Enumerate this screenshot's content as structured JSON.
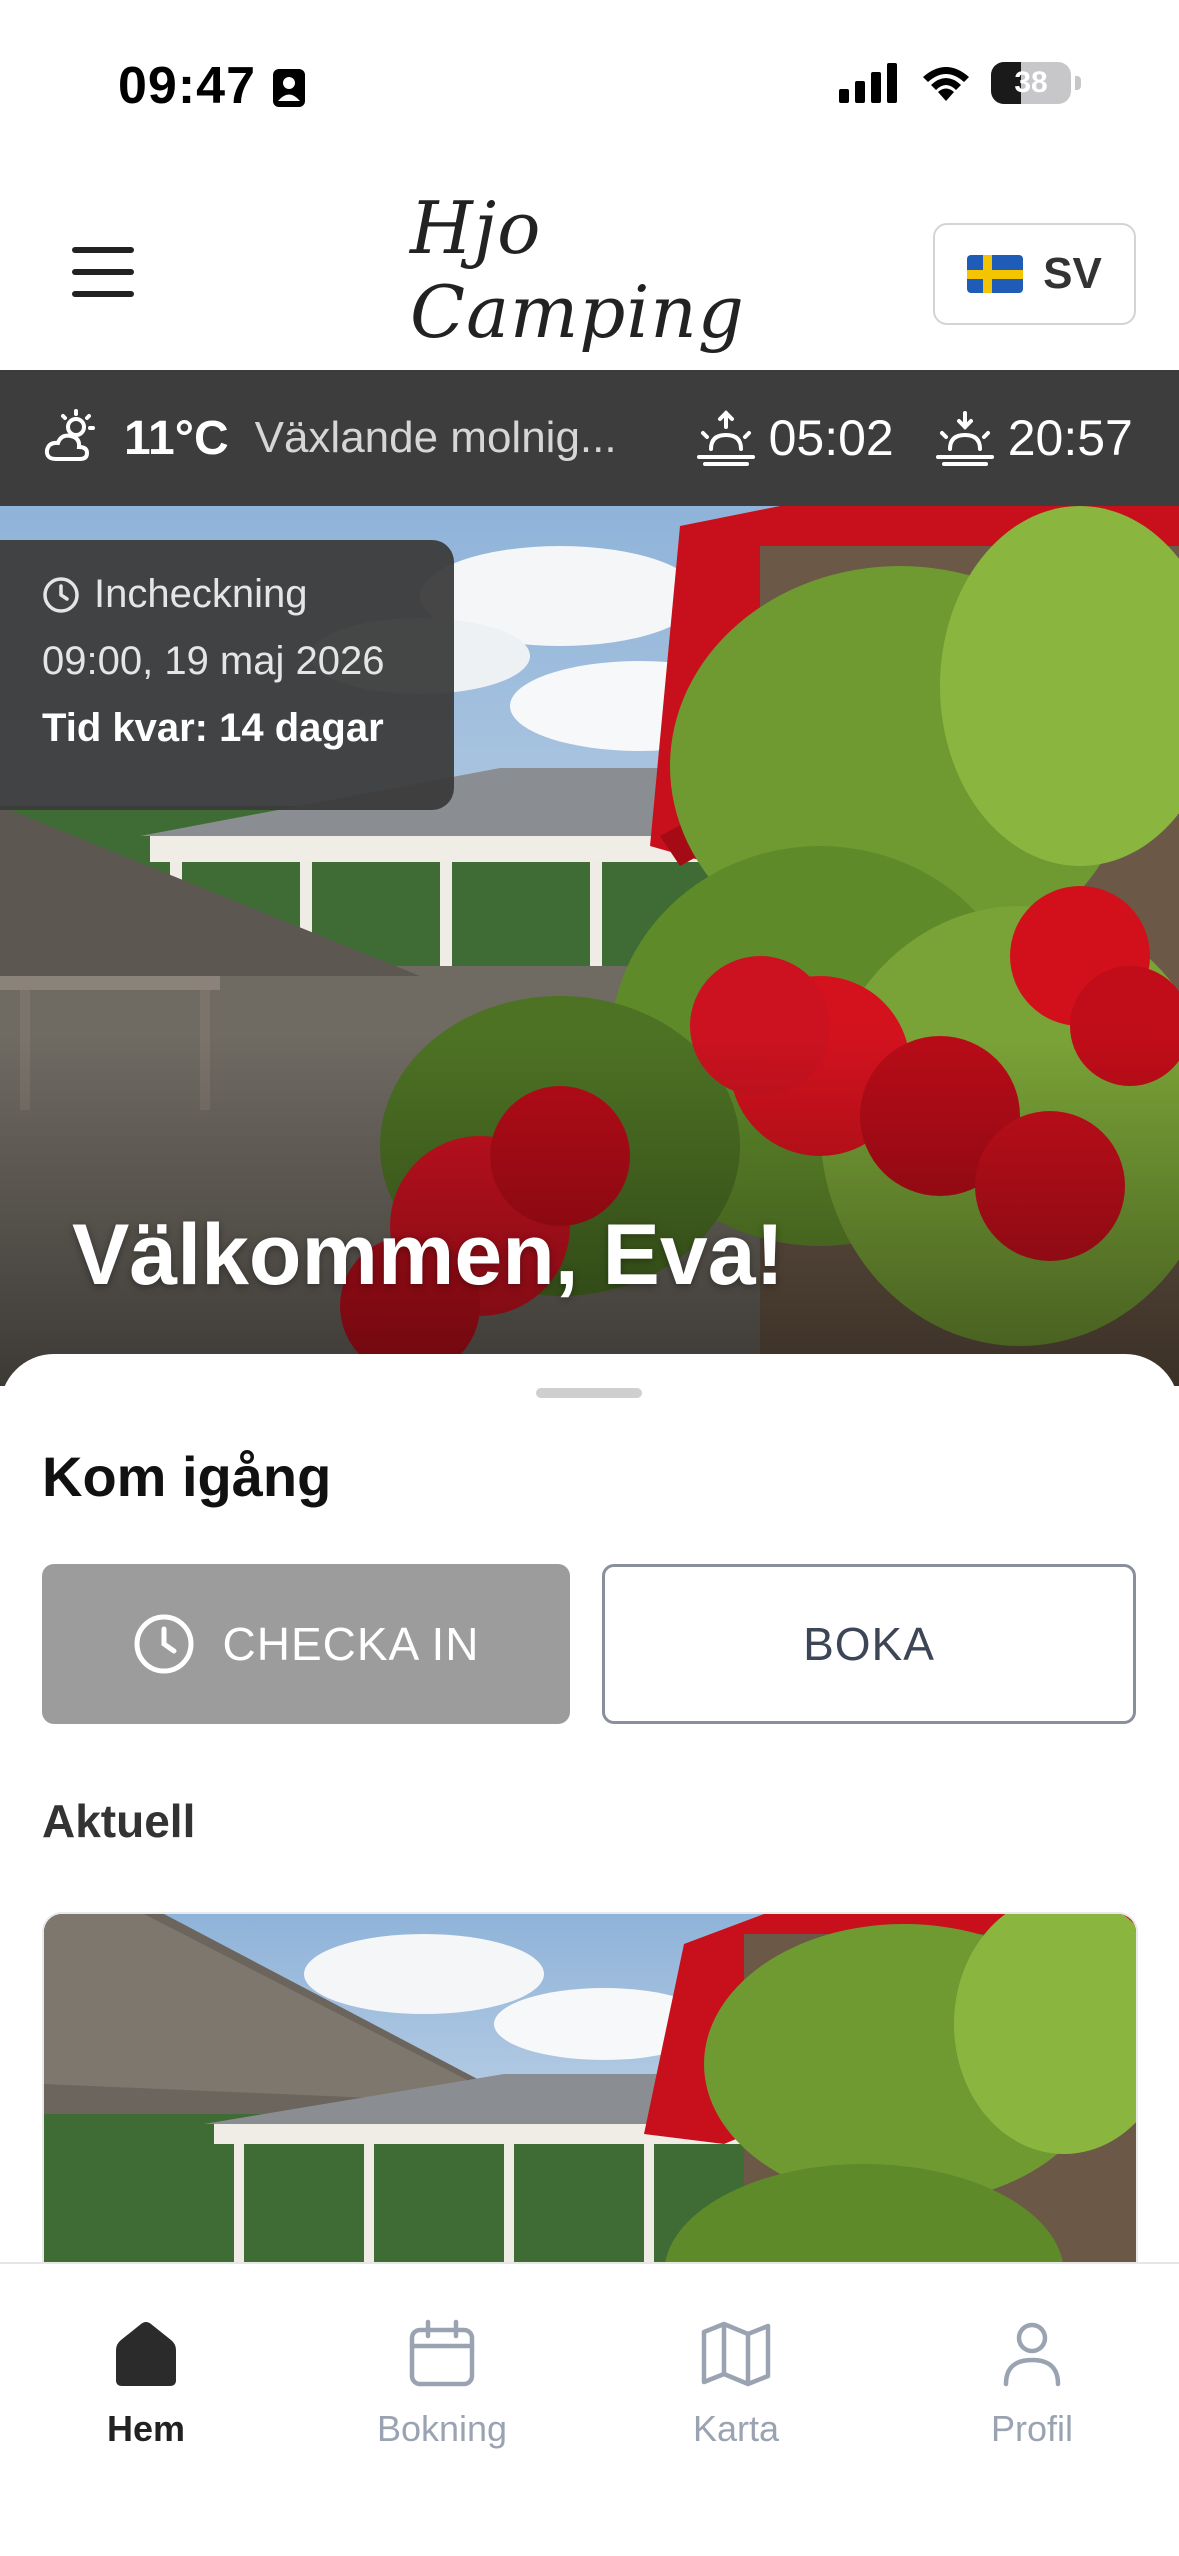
{
  "status_bar": {
    "time": "09:47",
    "battery": "38"
  },
  "header": {
    "logo_text": "Hjo Camping",
    "language": {
      "code": "SV",
      "flag": "sweden-flag"
    }
  },
  "weather": {
    "temperature": "11°C",
    "condition": "Växlande molnig...",
    "sunrise": "05:02",
    "sunset": "20:57",
    "icon": "partly-cloudy-icon"
  },
  "hero": {
    "checkin": {
      "label": "Incheckning",
      "datetime": "09:00, 19 maj 2026",
      "time_left": "Tid kvar: 14 dagar"
    },
    "welcome": "Välkommen, Eva!"
  },
  "sheet": {
    "title": "Kom igång",
    "checkin_button": "CHECKA IN",
    "book_button": "BOKA",
    "current_label": "Aktuell"
  },
  "tabbar": {
    "tabs": [
      {
        "label": "Hem",
        "icon": "home-icon",
        "active": true
      },
      {
        "label": "Bokning",
        "icon": "calendar-icon",
        "active": false
      },
      {
        "label": "Karta",
        "icon": "map-icon",
        "active": false
      },
      {
        "label": "Profil",
        "icon": "profile-icon",
        "active": false
      }
    ]
  },
  "colors": {
    "weather_bar": "#3d3d3d",
    "checkin_button": "#9c9c9c",
    "tab_inactive": "#9aa3b2",
    "awning_red": "#c8101c"
  }
}
